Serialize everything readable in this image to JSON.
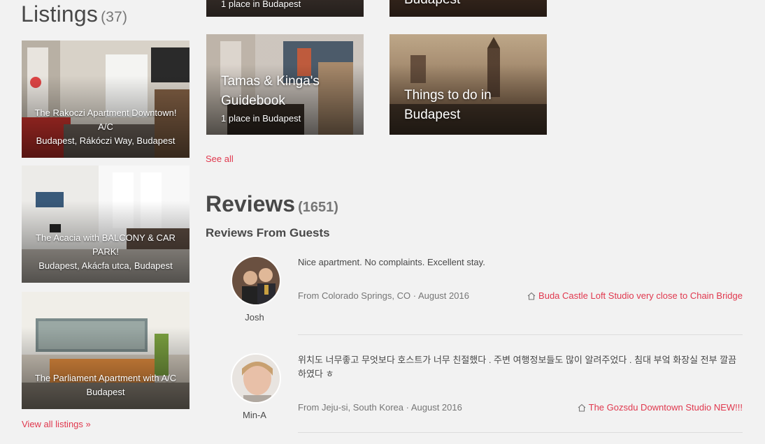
{
  "listings": {
    "heading": "Listings",
    "count": "(37)",
    "items": [
      {
        "title": "The Rakoczi Apartment Downtown! A/C",
        "location": "Budapest, Rákóczi Way, Budapest"
      },
      {
        "title": "The Acacia with BALCONY & CAR PARK!",
        "location": "Budapest, Akácfa utca, Budapest"
      },
      {
        "title": "The Parliament Apartment with A/C",
        "location": "Budapest"
      }
    ],
    "view_all": "View all listings »"
  },
  "guidebooks": {
    "top_left_sub": "1 place in Budapest",
    "top_right_title": "Budapest",
    "cards": [
      {
        "title_line1": "Tamas & Kinga's",
        "title_line2": "Guidebook",
        "sub": "1 place in Budapest"
      },
      {
        "title_line1": "Things to do in",
        "title_line2": "Budapest"
      }
    ],
    "see_all": "See all"
  },
  "reviews": {
    "heading": "Reviews",
    "count": "(1651)",
    "subheading": "Reviews From Guests",
    "items": [
      {
        "name": "Josh",
        "text": "Nice apartment. No complaints. Excellent stay.",
        "meta": "From Colorado Springs, CO · August 2016",
        "listing": "Buda Castle Loft Studio very close to Chain Bridge"
      },
      {
        "name": "Min-A",
        "text": "위치도 너무좋고 무엇보다 호스트가 너무 친절했다 . 주변 여행정보들도 많이 알려주었다 . 침대 부엌 화장실 전부 깔끔하였다 ㅎ",
        "meta": "From Jeju-si, South Korea · August 2016",
        "listing": "The Gozsdu Downtown Studio NEW!!!"
      }
    ]
  },
  "colors": {
    "accent": "#e0384e",
    "text": "#484848",
    "muted": "#767676",
    "background": "#f2f2f2"
  },
  "icons": {
    "listing_link": "home-icon"
  }
}
